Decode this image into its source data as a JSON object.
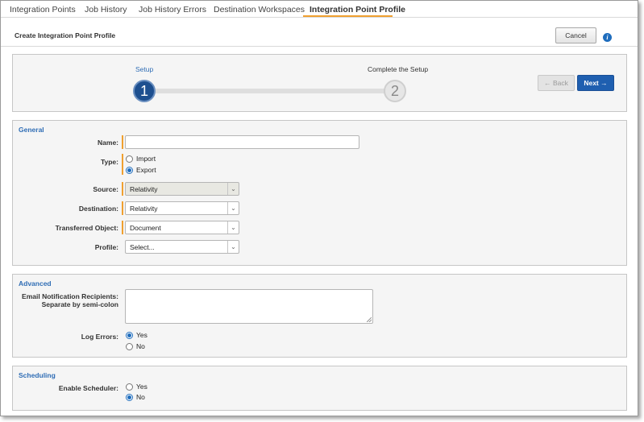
{
  "tabs": [
    {
      "label": "Integration Points"
    },
    {
      "label": "Job History"
    },
    {
      "label": "Job History Errors"
    },
    {
      "label": "Destination Workspaces"
    },
    {
      "label": "Integration Point Profile"
    }
  ],
  "active_tab": "Integration Point Profile",
  "header": {
    "title": "Create Integration Point Profile",
    "cancel_label": "Cancel",
    "info_icon": "info-icon",
    "info_glyph": "i"
  },
  "wizard": {
    "steps": [
      {
        "label": "Setup",
        "number": "1",
        "state": "active"
      },
      {
        "label": "Complete the Setup",
        "number": "2",
        "state": "inactive"
      }
    ],
    "back_label": "← Back",
    "next_label": "Next →"
  },
  "general": {
    "title": "General",
    "name_label": "Name:",
    "name_value": "",
    "type_label": "Type:",
    "type_options": [
      "Import",
      "Export"
    ],
    "type_selected": "Export",
    "source_label": "Source:",
    "source_value": "Relativity",
    "destination_label": "Destination:",
    "destination_value": "Relativity",
    "transferred_label": "Transferred Object:",
    "transferred_value": "Document",
    "profile_label": "Profile:",
    "profile_value": "Select..."
  },
  "advanced": {
    "title": "Advanced",
    "email_label_1": "Email Notification Recipients:",
    "email_label_2": "Separate by semi-colon",
    "email_value": "",
    "log_errors_label": "Log Errors:",
    "log_errors_options": [
      "Yes",
      "No"
    ],
    "log_errors_selected": "Yes"
  },
  "scheduling": {
    "title": "Scheduling",
    "enable_label": "Enable Scheduler:",
    "enable_options": [
      "Yes",
      "No"
    ],
    "enable_selected": "No"
  },
  "colors": {
    "accent": "#f0a030",
    "primary": "#1f5fb0",
    "link": "#2f6db5"
  }
}
